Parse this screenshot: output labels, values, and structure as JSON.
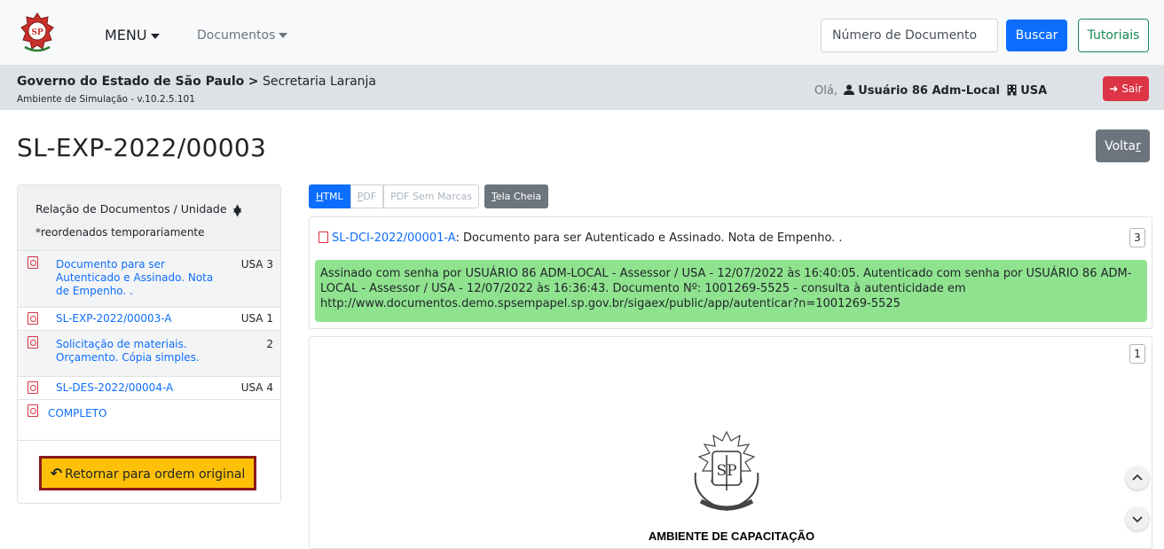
{
  "navbar": {
    "menu_label": "MENU",
    "documents_label": "Documentos",
    "search_placeholder": "Número de Documento",
    "search_button": "Buscar",
    "tutorials_button": "Tutoriais"
  },
  "breadcrumb": {
    "org": "Governo do Estado de São Paulo",
    "separator": ">",
    "unit": "Secretaria Laranja",
    "environment": "Ambiente de Simulação - v.10.2.5.101"
  },
  "user": {
    "greeting": "Olá,",
    "name": "Usuário 86 Adm-Local",
    "unit": "USA",
    "logout": "Sair"
  },
  "page": {
    "title": "SL-EXP-2022/00003",
    "back_button_prefix": "Volta",
    "back_button_underlined": "r"
  },
  "sidebar": {
    "title": "Relação de Documentos / Unidade",
    "sort_icon": "sort-icon",
    "note": "*reordenados temporariamente",
    "items": [
      {
        "label_lines": [
          "Documento para ser",
          "Autenticado e Assinado. Nota",
          "de Empenho. ."
        ],
        "unit": "USA",
        "count": "3"
      },
      {
        "label_lines": [
          "SL-EXP-2022/00003-A"
        ],
        "unit": "USA",
        "count": "1"
      },
      {
        "label_lines": [
          "Solicitação de materiais.",
          "Orçamento. Cópia simples."
        ],
        "unit": "",
        "count": "2"
      },
      {
        "label_lines": [
          "SL-DES-2022/00004-A"
        ],
        "unit": "USA",
        "count": "4"
      },
      {
        "label_lines": [
          "COMPLETO"
        ],
        "unit": "",
        "count": ""
      }
    ],
    "reset_button": "Retornar para ordem original"
  },
  "view_tabs": {
    "html_prefix": "",
    "html_underlined": "H",
    "html_rest": "TML",
    "pdf_underlined": "P",
    "pdf_rest": "DF",
    "pdf_nomarks": "PDF Sem Marcas",
    "fullscreen_underlined": "T",
    "fullscreen_rest": "ela Cheia"
  },
  "document": {
    "code": "SL-DCI-2022/00001-A",
    "description": ": Documento para ser Autenticado e Assinado. Nota de Empenho. .",
    "page_badge": "3",
    "signature_text": "Assinado com senha por USUÁRIO 86 ADM-LOCAL - Assessor / USA - 12/07/2022 às 16:40:05. Autenticado com senha por USUÁRIO 86 ADM-LOCAL - Assessor / USA - 12/07/2022 às 16:36:43. Documento Nº: 1001269-5525 - consulta à autenticidade em http://www.documentos.demo.spsempapel.sp.gov.br/sigaex/public/app/autenticar?n=1001269-5525"
  },
  "preview": {
    "page_badge": "1",
    "heading": "AMBIENTE DE CAPACITAÇÃO"
  },
  "colors": {
    "primary": "#0d6efd",
    "success": "#198754",
    "danger": "#dc3545",
    "secondary": "#6c757d",
    "warning": "#ffc107",
    "signature_bg": "#8fe38f"
  }
}
